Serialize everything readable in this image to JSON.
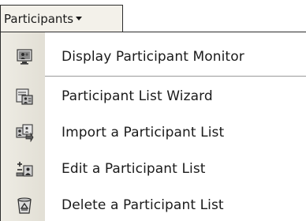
{
  "menu": {
    "title": "Participants",
    "items": [
      {
        "label": "Display Participant Monitor",
        "icon": "participant-monitor-icon"
      },
      {
        "label": "Participant List Wizard",
        "icon": "list-wizard-icon"
      },
      {
        "label": "Import a Participant List",
        "icon": "import-list-icon"
      },
      {
        "label": "Edit a Participant List",
        "icon": "edit-list-icon"
      },
      {
        "label": "Delete a Participant List",
        "icon": "delete-list-icon"
      }
    ]
  }
}
